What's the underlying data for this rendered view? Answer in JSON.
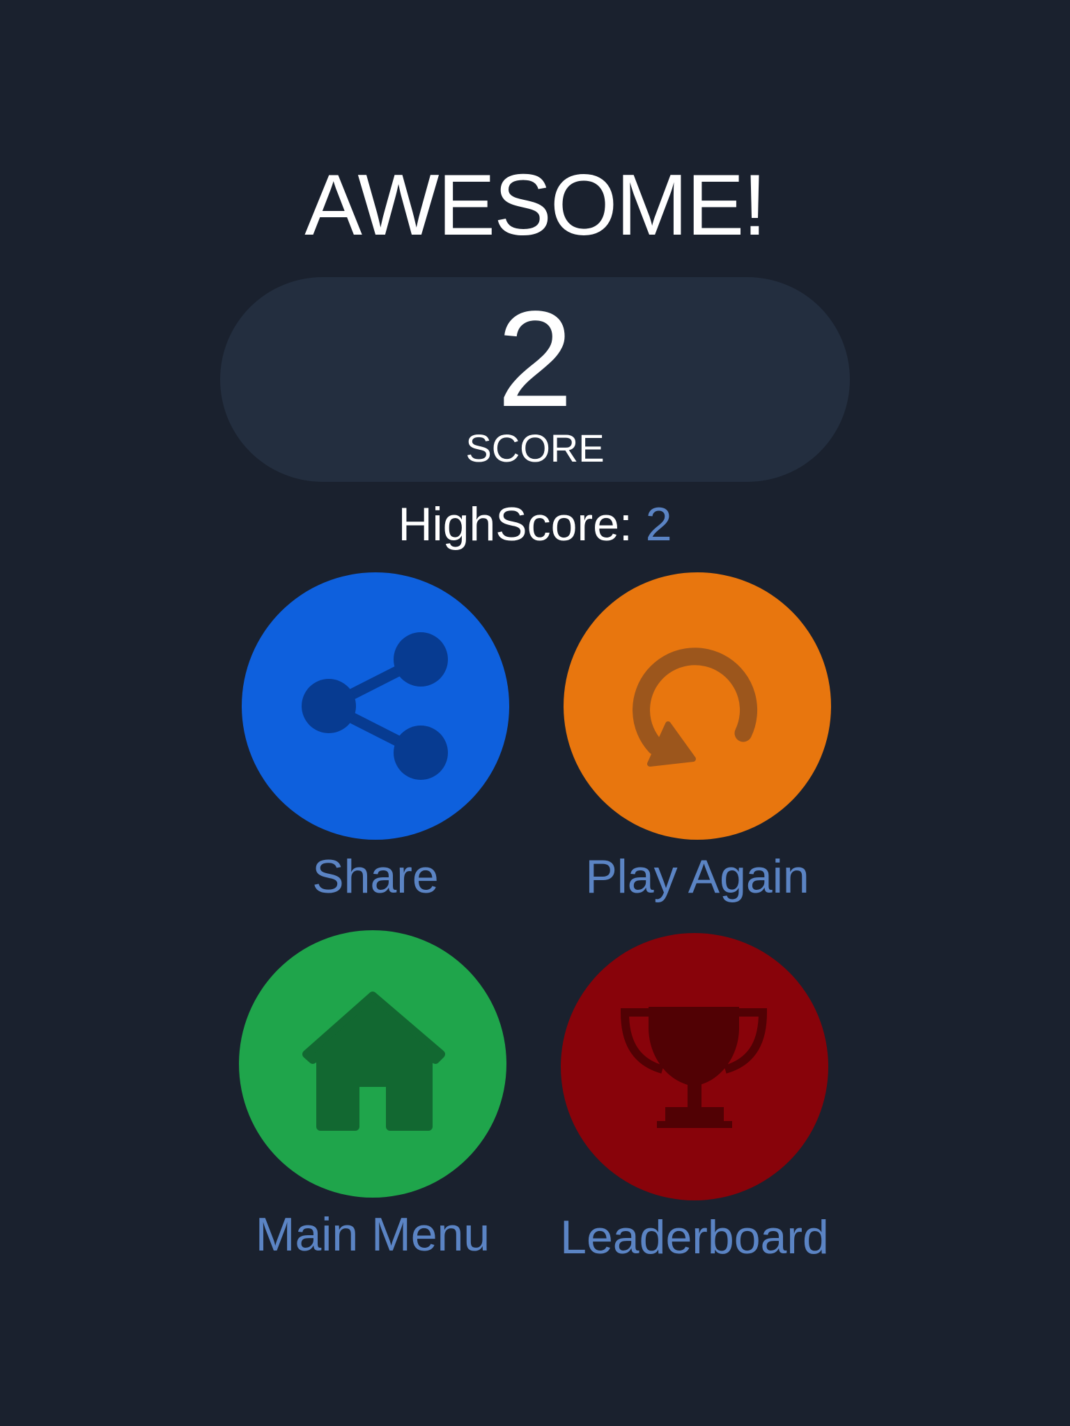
{
  "header": {
    "title": "AWESOME!"
  },
  "score": {
    "value": "2",
    "label": "SCORE"
  },
  "highscore": {
    "label": "HighScore:",
    "value": "2"
  },
  "actions": [
    {
      "label": "Share",
      "icon": "share-icon",
      "color": "#0e60dd",
      "icon_color": "#073b91"
    },
    {
      "label": "Play Again",
      "icon": "replay-icon",
      "color": "#e8760e",
      "icon_color": "#9c561c"
    },
    {
      "label": "Main Menu",
      "icon": "home-icon",
      "color": "#1fa54b",
      "icon_color": "#126831"
    },
    {
      "label": "Leaderboard",
      "icon": "trophy-icon",
      "color": "#88030a",
      "icon_color": "#510104"
    }
  ],
  "colors": {
    "background": "#1a212e",
    "score_pill": "#232e3f",
    "accent_text": "#5b84c4"
  }
}
